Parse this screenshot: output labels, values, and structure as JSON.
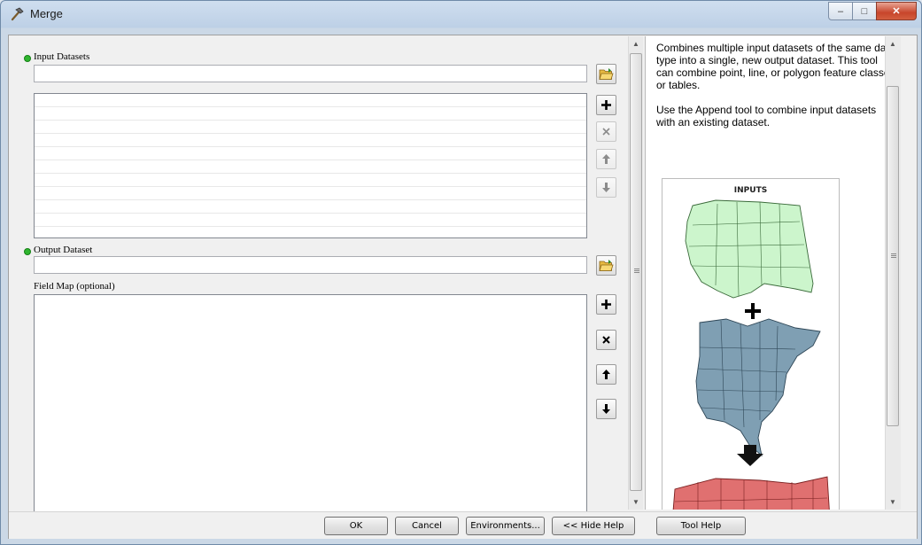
{
  "window": {
    "title": "Merge",
    "minimize_glyph": "–",
    "maximize_glyph": "□",
    "close_glyph": "✕"
  },
  "params": {
    "input_datasets_label": "Input Datasets",
    "input_datasets_value": "",
    "input_datasets_list": [
      "",
      "",
      "",
      "",
      "",
      "",
      "",
      "",
      "",
      ""
    ],
    "output_dataset_label": "Output Dataset",
    "output_dataset_value": "",
    "field_map_label": "Field Map (optional)"
  },
  "help": {
    "paragraphs": [
      "Combines multiple input datasets of the same data type into a single, new output dataset. This tool can combine point, line, or polygon feature classes or tables.",
      "Use the Append tool to combine input datasets with an existing dataset."
    ],
    "illustration_title": "INPUTS",
    "colors": {
      "west": "#ccf5cc",
      "east": "#7f9fb3",
      "merged": "#e07070"
    }
  },
  "buttons": {
    "ok": "OK",
    "cancel": "Cancel",
    "environments": "Environments...",
    "hide_help": "<< Hide Help",
    "tool_help": "Tool Help"
  },
  "icons": {
    "open": "folder-open-icon",
    "add": "plus-icon",
    "remove": "x-icon",
    "up": "arrow-up-icon",
    "down": "arrow-down-icon"
  }
}
